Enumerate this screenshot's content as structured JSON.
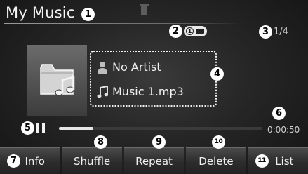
{
  "title": "My Music",
  "track_count": "1/4",
  "usb": {
    "number": "1"
  },
  "track": {
    "artist": "No Artist",
    "file": "Music 1.mp3"
  },
  "playback": {
    "state": "paused",
    "elapsed": "0:00:50",
    "progress": 0.17
  },
  "buttons": [
    {
      "id": "info",
      "label": "Info"
    },
    {
      "id": "shuffle",
      "label": "Shuffle"
    },
    {
      "id": "repeat",
      "label": "Repeat"
    },
    {
      "id": "delete",
      "label": "Delete"
    },
    {
      "id": "list",
      "label": "List"
    }
  ],
  "callouts": [
    "1",
    "2",
    "3",
    "4",
    "5",
    "6",
    "7",
    "8",
    "9",
    "10",
    "11"
  ],
  "colors": {
    "background": "#262626",
    "text": "#f2f2f2",
    "callout": "#ffffff"
  },
  "icons": [
    "trash-icon",
    "usb-icon",
    "folder-music-icon",
    "person-icon",
    "music-note-icon",
    "pause-icon"
  ]
}
